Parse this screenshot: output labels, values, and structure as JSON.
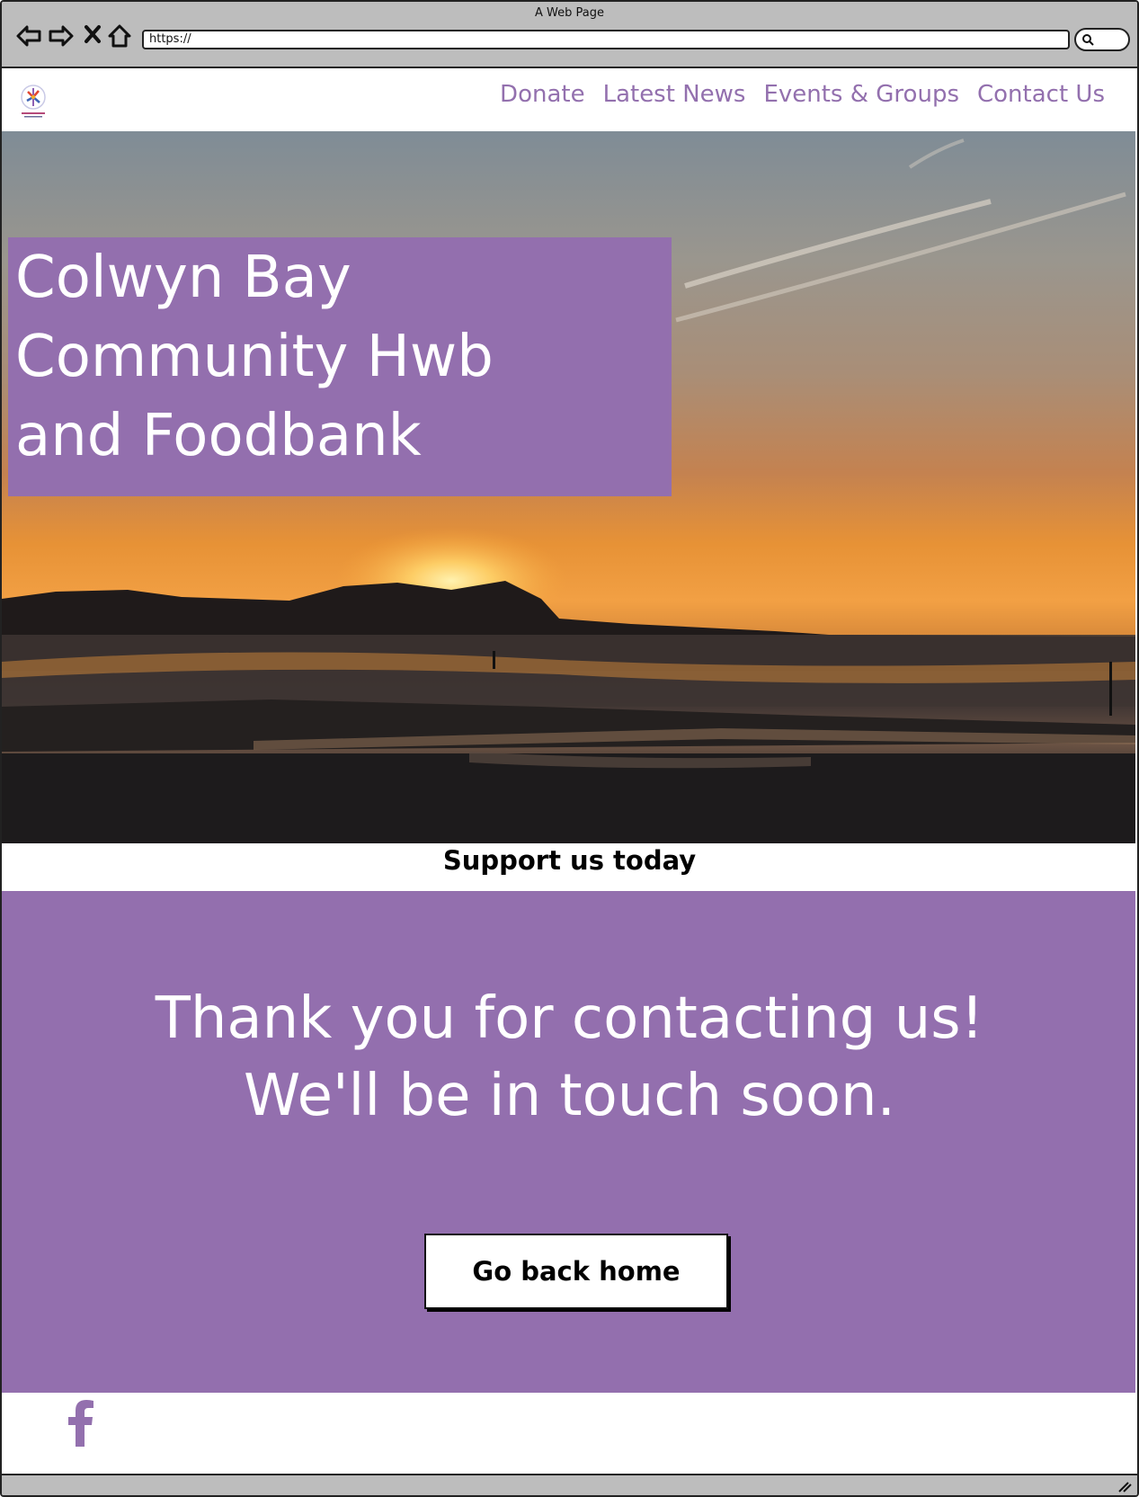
{
  "browser": {
    "window_title": "A Web Page",
    "url": "https://"
  },
  "nav": {
    "items": [
      "Donate",
      "Latest News",
      "Events & Groups",
      "Contact Us"
    ]
  },
  "hero": {
    "title_lines": [
      "Colwyn Bay",
      "Community Hwb",
      "and Foodbank"
    ]
  },
  "support": {
    "label": "Support us today"
  },
  "message": {
    "lines": [
      "Thank you for contacting us!",
      "We'll be in touch soon."
    ],
    "button_label": "Go back home"
  },
  "colors": {
    "accent": "#936fae",
    "nav_text": "#9370ae"
  },
  "icons": {
    "social": "facebook-icon",
    "logo": "site-logo"
  }
}
